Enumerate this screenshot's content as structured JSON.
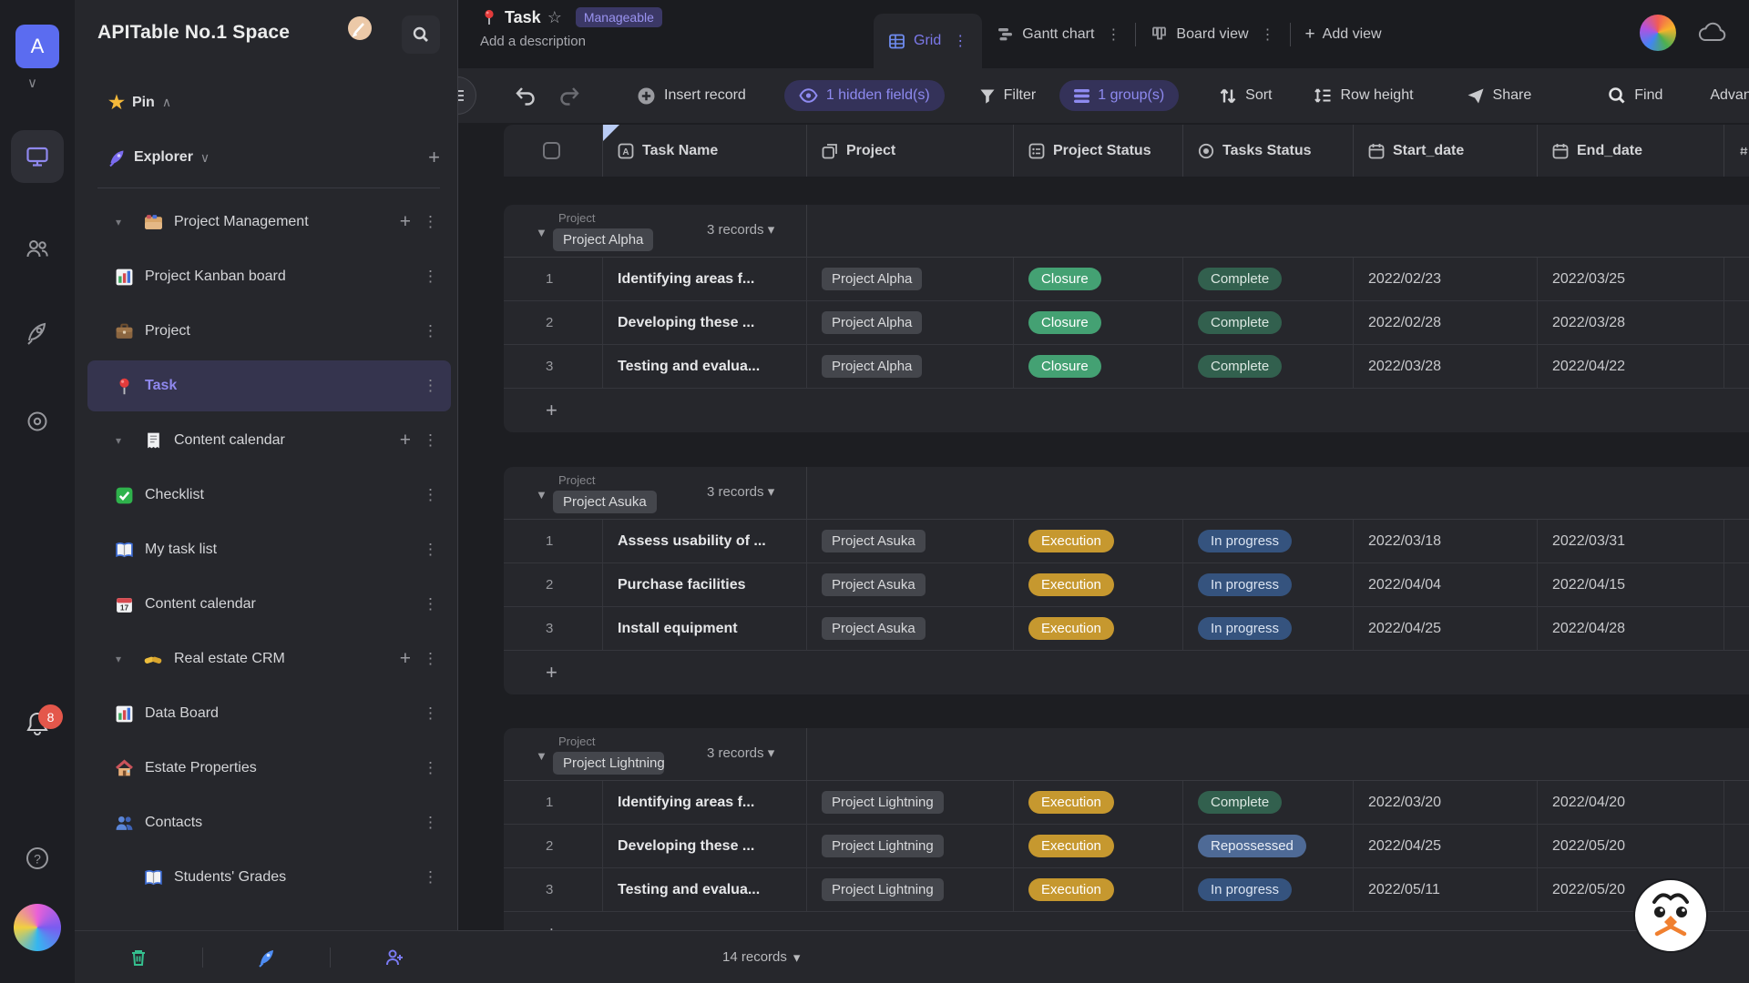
{
  "space": {
    "name": "APITable No.1 Space"
  },
  "rail": {
    "avatar_letter": "A",
    "notification_count": "8",
    "icons": [
      "workbench-icon",
      "contacts-icon",
      "templates-icon",
      "settings-icon",
      "bell-icon",
      "help-icon"
    ]
  },
  "sidebar": {
    "pin_label": "Pin",
    "explorer_label": "Explorer",
    "tree": [
      {
        "type": "folder",
        "icon": "card-index-icon",
        "label": "Project Management"
      },
      {
        "type": "child",
        "icon": "bar-chart-icon",
        "label": "Project Kanban board"
      },
      {
        "type": "child",
        "icon": "briefcase-icon",
        "label": "Project"
      },
      {
        "type": "child",
        "icon": "pushpin-icon",
        "label": "Task",
        "selected": true
      },
      {
        "type": "folder",
        "icon": "receipt-icon",
        "label": "Content calendar"
      },
      {
        "type": "child",
        "icon": "checklist-icon",
        "label": "Checklist"
      },
      {
        "type": "child",
        "icon": "book-icon",
        "label": "My task list"
      },
      {
        "type": "child",
        "icon": "calendar-icon",
        "label": "Content calendar"
      },
      {
        "type": "folder",
        "icon": "handshake-icon",
        "label": "Real estate CRM"
      },
      {
        "type": "child",
        "icon": "bar-chart-icon",
        "label": "Data Board"
      },
      {
        "type": "child",
        "icon": "house-icon",
        "label": "Estate Properties"
      },
      {
        "type": "child",
        "icon": "people-icon",
        "label": "Contacts"
      },
      {
        "type": "folder2",
        "icon": "book-icon",
        "label": "Students' Grades"
      }
    ]
  },
  "header": {
    "sheet_title": "Task",
    "badge": "Manageable",
    "description_placeholder": "Add a description",
    "tabs": {
      "grid": "Grid",
      "gantt": "Gantt chart",
      "board": "Board view",
      "add_view": "Add view"
    }
  },
  "toolbar": {
    "insert_record": "Insert record",
    "hidden_fields": "1 hidden field(s)",
    "filter": "Filter",
    "groups": "1 group(s)",
    "sort": "Sort",
    "row_height": "Row height",
    "share": "Share",
    "find": "Find",
    "advanced": "Advanced"
  },
  "table": {
    "columns": [
      {
        "label": "Task Name",
        "icon": "text-field-icon"
      },
      {
        "label": "Project",
        "icon": "link-field-icon"
      },
      {
        "label": "Project Status",
        "icon": "select-field-icon"
      },
      {
        "label": "Tasks Status",
        "icon": "status-field-icon"
      },
      {
        "label": "Start_date",
        "icon": "date-field-icon"
      },
      {
        "label": "End_date",
        "icon": "date-field-icon"
      }
    ],
    "group_field_label": "Project",
    "groups": [
      {
        "name": "Project Alpha",
        "count_label": "3 records",
        "rows": [
          {
            "num": "1",
            "task": "Identifying areas f...",
            "project": "Project Alpha",
            "project_status": "Closure",
            "tasks_status": "Complete",
            "start": "2022/02/23",
            "end": "2022/03/25"
          },
          {
            "num": "2",
            "task": "Developing these ...",
            "project": "Project Alpha",
            "project_status": "Closure",
            "tasks_status": "Complete",
            "start": "2022/02/28",
            "end": "2022/03/28"
          },
          {
            "num": "3",
            "task": "Testing and evalua...",
            "project": "Project Alpha",
            "project_status": "Closure",
            "tasks_status": "Complete",
            "start": "2022/03/28",
            "end": "2022/04/22"
          }
        ]
      },
      {
        "name": "Project Asuka",
        "count_label": "3 records",
        "rows": [
          {
            "num": "1",
            "task": "Assess usability of ...",
            "project": "Project Asuka",
            "project_status": "Execution",
            "tasks_status": "In progress",
            "start": "2022/03/18",
            "end": "2022/03/31"
          },
          {
            "num": "2",
            "task": "Purchase facilities",
            "project": "Project Asuka",
            "project_status": "Execution",
            "tasks_status": "In progress",
            "start": "2022/04/04",
            "end": "2022/04/15"
          },
          {
            "num": "3",
            "task": "Install equipment",
            "project": "Project Asuka",
            "project_status": "Execution",
            "tasks_status": "In progress",
            "start": "2022/04/25",
            "end": "2022/04/28"
          }
        ]
      },
      {
        "name": "Project Lightning",
        "count_label": "3 records",
        "rows": [
          {
            "num": "1",
            "task": "Identifying areas f...",
            "project": "Project Lightning",
            "project_status": "Execution",
            "tasks_status": "Complete",
            "start": "2022/03/20",
            "end": "2022/04/20"
          },
          {
            "num": "2",
            "task": "Developing these ...",
            "project": "Project Lightning",
            "project_status": "Execution",
            "tasks_status": "Repossessed",
            "start": "2022/04/25",
            "end": "2022/05/20"
          },
          {
            "num": "3",
            "task": "Testing and evalua...",
            "project": "Project Lightning",
            "project_status": "Execution",
            "tasks_status": "In progress",
            "start": "2022/05/11",
            "end": "2022/05/20"
          }
        ]
      }
    ],
    "footer_label": "14 records"
  },
  "colors": {
    "accent_purple": "#8d87f0",
    "pill_purple_bg": "#343259",
    "chip_bg": "#44464c",
    "status": {
      "Closure": {
        "bg": "#44a173",
        "fg": "#ffffff"
      },
      "Execution": {
        "bg": "#c6982f",
        "fg": "#ffffff"
      },
      "Complete": {
        "bg": "#32604e",
        "fg": "#dce8e2"
      },
      "In progress": {
        "bg": "#35537e",
        "fg": "#dbe4f2"
      },
      "Repossessed": {
        "bg": "#4e6a96",
        "fg": "#e8edf5"
      }
    }
  }
}
